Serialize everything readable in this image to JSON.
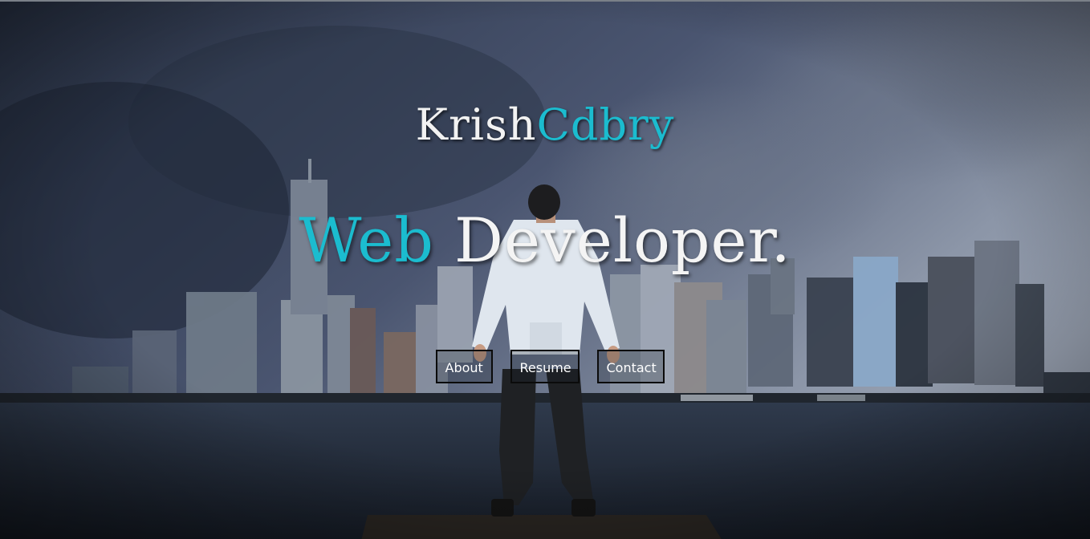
{
  "brand": {
    "first": "Krish",
    "second": "Cdbry"
  },
  "headline": {
    "accent": "Web",
    "rest": " Developer."
  },
  "nav": {
    "about": "About",
    "resume": "Resume",
    "contact": "Contact"
  },
  "colors": {
    "accent": "#1bbccf",
    "text": "#f2f2f2",
    "button_border": "#0b0b0b"
  }
}
